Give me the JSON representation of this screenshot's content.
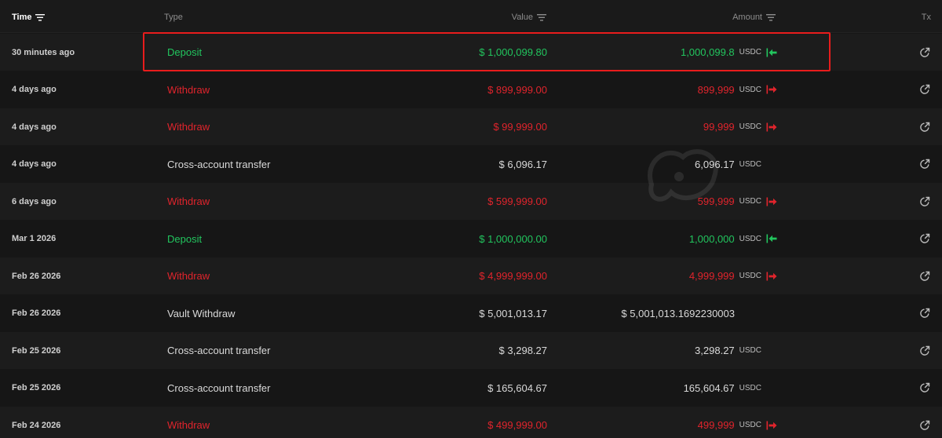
{
  "header": {
    "time": "Time",
    "type": "Type",
    "value": "Value",
    "amount": "Amount",
    "tx": "Tx"
  },
  "rows": [
    {
      "time": "30 minutes ago",
      "type": "Deposit",
      "value": "$ 1,000,099.80",
      "amount": "1,000,099.8",
      "unit": "USDC",
      "kind": "deposit"
    },
    {
      "time": "4 days ago",
      "type": "Withdraw",
      "value": "$ 899,999.00",
      "amount": "899,999",
      "unit": "USDC",
      "kind": "withdraw"
    },
    {
      "time": "4 days ago",
      "type": "Withdraw",
      "value": "$ 99,999.00",
      "amount": "99,999",
      "unit": "USDC",
      "kind": "withdraw"
    },
    {
      "time": "4 days ago",
      "type": "Cross-account transfer",
      "value": "$ 6,096.17",
      "amount": "6,096.17",
      "unit": "USDC",
      "kind": "transfer"
    },
    {
      "time": "6 days ago",
      "type": "Withdraw",
      "value": "$ 599,999.00",
      "amount": "599,999",
      "unit": "USDC",
      "kind": "withdraw"
    },
    {
      "time": "Mar 1 2026",
      "type": "Deposit",
      "value": "$ 1,000,000.00",
      "amount": "1,000,000",
      "unit": "USDC",
      "kind": "deposit"
    },
    {
      "time": "Feb 26 2026",
      "type": "Withdraw",
      "value": "$ 4,999,999.00",
      "amount": "4,999,999",
      "unit": "USDC",
      "kind": "withdraw"
    },
    {
      "time": "Feb 26 2026",
      "type": "Vault Withdraw",
      "value": "$ 5,001,013.17",
      "amount": "$ 5,001,013.1692230003",
      "unit": "",
      "kind": "vault"
    },
    {
      "time": "Feb 25 2026",
      "type": "Cross-account transfer",
      "value": "$ 3,298.27",
      "amount": "3,298.27",
      "unit": "USDC",
      "kind": "transfer"
    },
    {
      "time": "Feb 25 2026",
      "type": "Cross-account transfer",
      "value": "$ 165,604.67",
      "amount": "165,604.67",
      "unit": "USDC",
      "kind": "transfer"
    },
    {
      "time": "Feb 24 2026",
      "type": "Withdraw",
      "value": "$ 499,999.00",
      "amount": "499,999",
      "unit": "USDC",
      "kind": "withdraw"
    }
  ],
  "colors": {
    "deposit": "#22c55e",
    "withdraw": "#e0242c",
    "neutral": "#d9d9d9",
    "highlight_border": "#e81c1c"
  },
  "icons": {
    "sort": "filter-icon",
    "tx": "external-link-icon",
    "deposit_direction": "arrow-in-icon",
    "withdraw_direction": "arrow-out-icon"
  }
}
